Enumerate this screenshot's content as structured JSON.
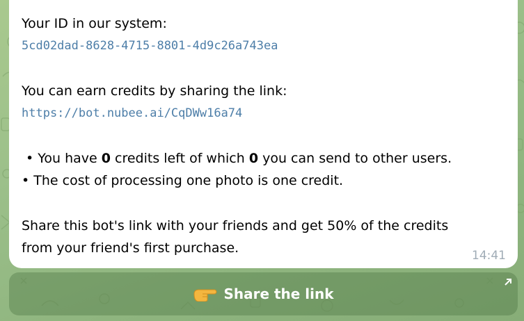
{
  "message": {
    "id_label": "Your ID in our system:",
    "id_value": "5cd02dad-8628-4715-8801-4d9c26a743ea",
    "earn_label": "You can earn credits by sharing the link:",
    "link_value": "https://bot.nubee.ai/CqDWw16a74",
    "credits_line": {
      "prefix": " • You have ",
      "credits": "0",
      "middle": " credits left of which ",
      "sendable": "0",
      "suffix": " you can send to other users."
    },
    "cost_line": "• The cost of processing one photo is one credit.",
    "share_line_1": "Share this bot's link with your friends and get 50% of the credits",
    "share_line_2": "from your friend's first purchase.",
    "time": "14:41"
  },
  "share_button": {
    "label": "Share the link",
    "icon": "pointing-hand-icon",
    "corner_icon": "external-arrow-icon"
  },
  "colors": {
    "link": "#4d7ea8",
    "timestamp": "#a0acb6",
    "wallpaper": "#9cc08a"
  }
}
